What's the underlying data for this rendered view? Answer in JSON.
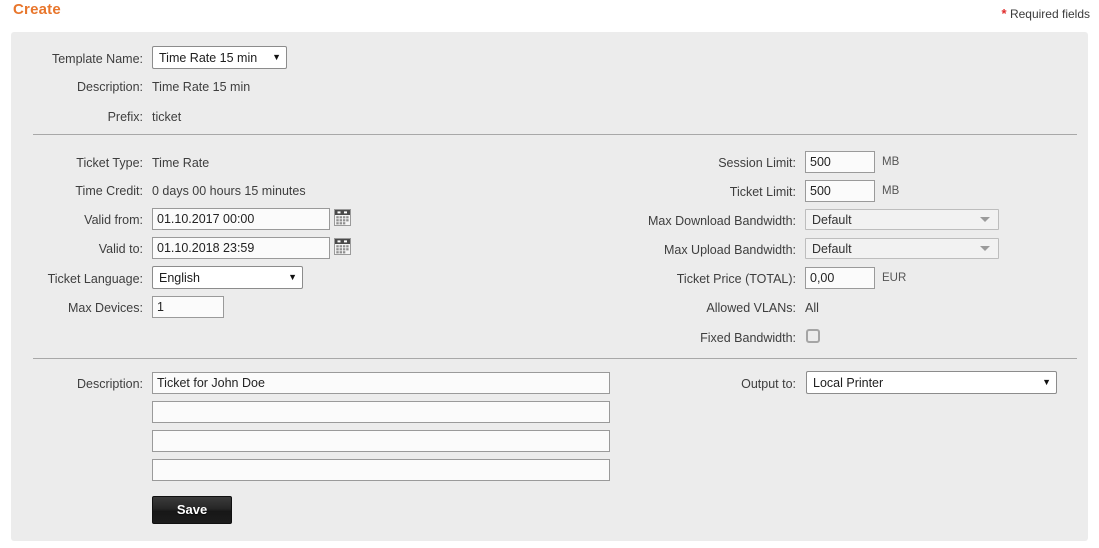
{
  "header": {
    "title": "Create",
    "required_star": "*",
    "required_label": "Required fields",
    "title_color": "#e8762c",
    "star_color": "#e02b2b"
  },
  "template_section": {
    "template_name_label": "Template Name:",
    "template_name_value": "Time Rate 15 min",
    "description_label": "Description:",
    "description_value": "Time Rate 15 min",
    "prefix_label": "Prefix:",
    "prefix_value": "ticket"
  },
  "details_left": {
    "ticket_type_label": "Ticket Type:",
    "ticket_type_value": "Time Rate",
    "time_credit_label": "Time Credit:",
    "time_credit_value": "0 days 00 hours 15 minutes",
    "valid_from_label": "Valid from:",
    "valid_from_value": "01.10.2017 00:00",
    "valid_to_label": "Valid to:",
    "valid_to_value": "01.10.2018 23:59",
    "ticket_language_label": "Ticket Language:",
    "ticket_language_value": "English",
    "max_devices_label": "Max Devices:",
    "max_devices_value": "1"
  },
  "details_right": {
    "session_limit_label": "Session Limit:",
    "session_limit_value": "500",
    "session_limit_unit": "MB",
    "ticket_limit_label": "Ticket Limit:",
    "ticket_limit_value": "500",
    "ticket_limit_unit": "MB",
    "max_download_label": "Max Download Bandwidth:",
    "max_download_value": "Default",
    "max_upload_label": "Max Upload Bandwidth:",
    "max_upload_value": "Default",
    "ticket_price_label": "Ticket Price (TOTAL):",
    "ticket_price_value": "0,00",
    "ticket_price_unit": "EUR",
    "allowed_vlans_label": "Allowed VLANs:",
    "allowed_vlans_value": "All",
    "fixed_bandwidth_label": "Fixed Bandwidth:",
    "fixed_bandwidth_checked": false
  },
  "bottom_section": {
    "description_label": "Description:",
    "description_line_1": "Ticket for John Doe",
    "description_line_2": "",
    "description_line_3": "",
    "description_line_4": "",
    "description_placeholder": "",
    "output_to_label": "Output to:",
    "output_to_value": "Local Printer",
    "save_label": "Save"
  },
  "icons": {
    "calendar_from": "calendar-icon",
    "calendar_to": "calendar-icon"
  }
}
